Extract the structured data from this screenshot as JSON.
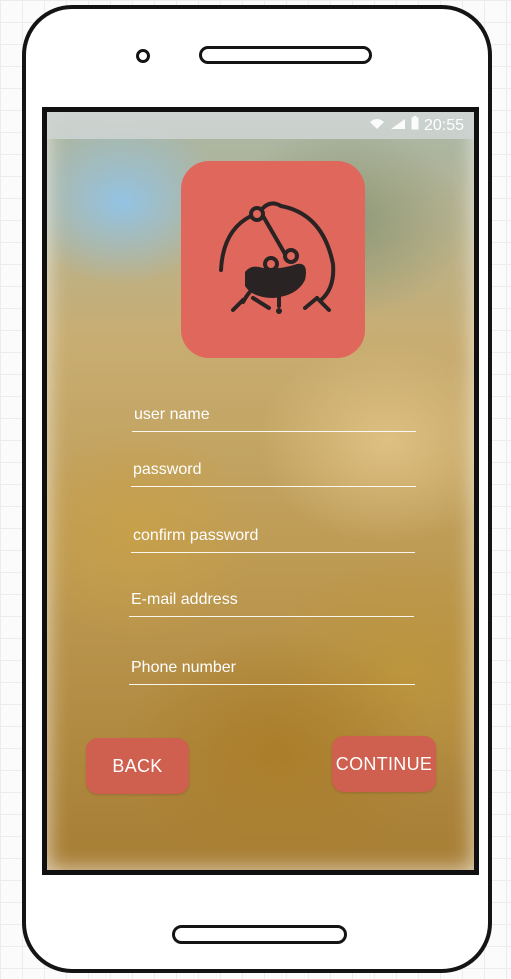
{
  "status_bar": {
    "time": "20:55",
    "icons": [
      "wifi-icon",
      "signal-icon",
      "battery-icon"
    ]
  },
  "app_logo": {
    "icon": "chef-mascot-logo-icon",
    "background_color": "#e0675b"
  },
  "form": {
    "username_placeholder": "user name",
    "password_placeholder": "password",
    "confirm_password_placeholder": "confirm password",
    "email_placeholder": "E-mail address",
    "phone_placeholder": "Phone number"
  },
  "buttons": {
    "back_label": "BACK",
    "continue_label": "CONTINUE",
    "color": "#cf5f4e"
  }
}
